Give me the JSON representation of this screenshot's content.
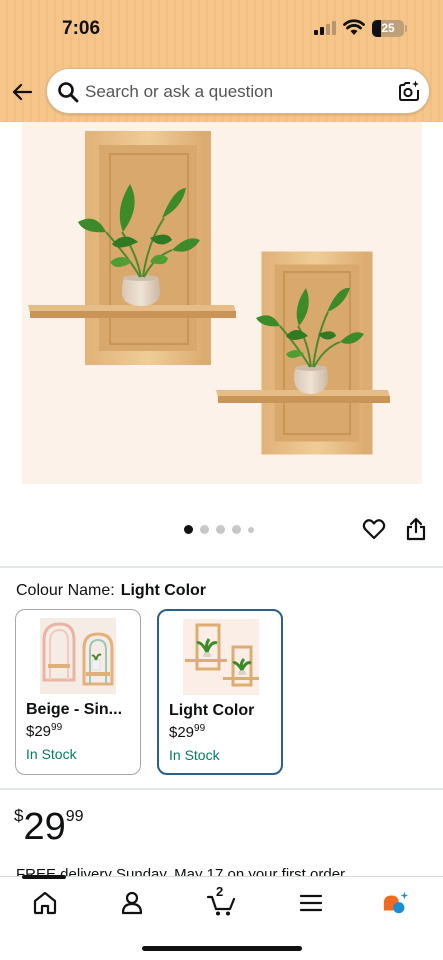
{
  "status_bar": {
    "time": "7:06",
    "battery": "25"
  },
  "header": {
    "search_placeholder": "Search or ask a question",
    "back_icon": "arrow-left-icon",
    "camera_icon": "camera-sparkle-icon",
    "background_color": "#f5c58a"
  },
  "gallery": {
    "dot_count": 5,
    "active_index": 0,
    "actions": [
      "heart-icon",
      "share-icon"
    ]
  },
  "colour": {
    "label": "Colour Name:",
    "selected": "Light Color",
    "options": [
      {
        "name": "Beige - Sin...",
        "price_whole": "$29",
        "price_frac": "99",
        "stock": "In Stock",
        "selected": false
      },
      {
        "name": "Light Color",
        "price_whole": "$29",
        "price_frac": "99",
        "stock": "In Stock",
        "selected": true
      }
    ]
  },
  "price": {
    "symbol": "$",
    "whole": "29",
    "fraction": "99"
  },
  "delivery": {
    "text": "FREE delivery Sunday, May 17 on your first order"
  },
  "bottom_nav": {
    "items": [
      "home-icon",
      "account-icon",
      "cart-icon",
      "menu-icon",
      "rufus-icon"
    ],
    "cart_count": "2",
    "selected_color": "#2b5f8c",
    "in_stock_color": "#067d62"
  }
}
